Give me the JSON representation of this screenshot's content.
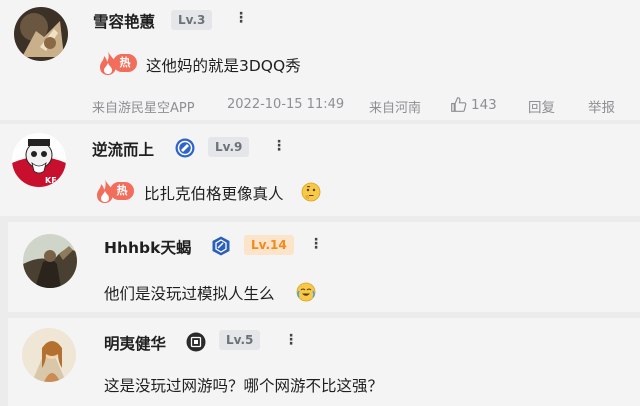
{
  "comments": [
    {
      "username": "雪容艳蕙",
      "level": "Lv.3",
      "more": "⋮",
      "hot_label": "热",
      "text": "这他妈的就是3DQQ秀",
      "source": "来自游民星空APP",
      "time": "2022-10-15 11:49",
      "location": "来自河南",
      "likes": "143",
      "reply_label": "回复",
      "report_label": "举报"
    },
    {
      "username": "逆流而上",
      "level": "Lv.9",
      "more": "⋮",
      "hot_label": "热",
      "text": "比扎克伯格更像真人",
      "badge_icon": "blue-medal-icon",
      "emoji": "thinking-emoji-icon"
    },
    {
      "username": "Hhhbk天蝎",
      "level": "Lv.14",
      "more": "⋮",
      "text": "他们是没玩过模拟人生么",
      "badge_icon": "hexagon-badge-icon",
      "emoji": "crying-laughing-emoji-icon"
    },
    {
      "username": "明夷健华",
      "level": "Lv.5",
      "more": "⋮",
      "text": "这是没玩过网游吗？哪个网游不比这强？",
      "badge_icon": "square-badge-icon"
    }
  ],
  "colors": {
    "card_bg": "#f4f4f5",
    "page_bg": "#ececec",
    "hot_red": "#f26d5b",
    "level_orange": "#f08a1d",
    "meta_gray": "#8d8f93"
  }
}
